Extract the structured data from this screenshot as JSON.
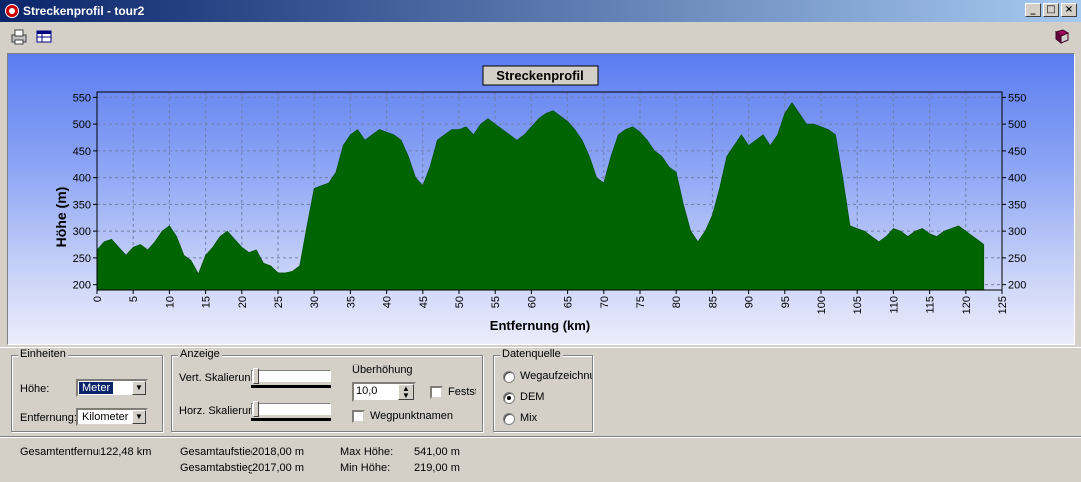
{
  "window": {
    "title": "Streckenprofil - tour2",
    "buttons": [
      "_",
      "□",
      "×"
    ]
  },
  "toolbar": {
    "icons": [
      "printer-icon",
      "table-icon",
      "book-icon"
    ]
  },
  "chart_data": {
    "type": "area",
    "title": "Streckenprofil",
    "xlabel": "Entfernung (km)",
    "ylabel": "Höhe (m)",
    "xlim": [
      0,
      125
    ],
    "ylim": [
      190,
      560
    ],
    "xticks": [
      0,
      5,
      10,
      15,
      20,
      25,
      30,
      35,
      40,
      45,
      50,
      55,
      60,
      65,
      70,
      75,
      80,
      85,
      90,
      95,
      100,
      105,
      110,
      115,
      120,
      125
    ],
    "yticks": [
      200,
      250,
      300,
      350,
      400,
      450,
      500,
      550
    ],
    "grid": true,
    "color": "#006400",
    "x": [
      0,
      1,
      2,
      3,
      4,
      5,
      6,
      7,
      8,
      9,
      10,
      11,
      12,
      13,
      14,
      15,
      16,
      17,
      18,
      19,
      20,
      21,
      22,
      23,
      24,
      25,
      26,
      27,
      28,
      29,
      30,
      31,
      32,
      33,
      34,
      35,
      36,
      37,
      38,
      39,
      40,
      41,
      42,
      43,
      44,
      45,
      46,
      47,
      48,
      49,
      50,
      51,
      52,
      53,
      54,
      55,
      56,
      57,
      58,
      59,
      60,
      61,
      62,
      63,
      64,
      65,
      66,
      67,
      68,
      69,
      70,
      71,
      72,
      73,
      74,
      75,
      76,
      77,
      78,
      79,
      80,
      81,
      82,
      83,
      84,
      85,
      86,
      87,
      88,
      89,
      90,
      91,
      92,
      93,
      94,
      95,
      96,
      97,
      98,
      99,
      100,
      101,
      102,
      103,
      104,
      105,
      106,
      107,
      108,
      109,
      110,
      111,
      112,
      113,
      114,
      115,
      116,
      117,
      118,
      119,
      120,
      121,
      122,
      122.48
    ],
    "values": [
      265,
      280,
      285,
      270,
      255,
      270,
      275,
      265,
      280,
      300,
      310,
      290,
      255,
      245,
      220,
      255,
      270,
      290,
      300,
      285,
      270,
      260,
      265,
      240,
      235,
      222,
      222,
      225,
      235,
      310,
      380,
      385,
      390,
      410,
      460,
      480,
      490,
      470,
      480,
      490,
      485,
      480,
      470,
      440,
      400,
      385,
      420,
      470,
      480,
      490,
      490,
      495,
      480,
      500,
      510,
      500,
      490,
      480,
      470,
      480,
      495,
      510,
      520,
      525,
      515,
      505,
      490,
      470,
      440,
      400,
      390,
      440,
      480,
      490,
      495,
      485,
      470,
      450,
      440,
      420,
      410,
      350,
      300,
      280,
      300,
      330,
      380,
      440,
      460,
      480,
      460,
      470,
      480,
      460,
      480,
      520,
      540,
      520,
      500,
      500,
      495,
      490,
      480,
      400,
      310,
      305,
      300,
      290,
      280,
      290,
      305,
      300,
      290,
      300,
      305,
      295,
      290,
      300,
      305,
      310,
      300,
      290,
      280,
      275,
      285,
      280,
      275,
      270
    ]
  },
  "einheiten": {
    "title": "Einheiten",
    "hoehe_label": "Höhe:",
    "hoehe_value": "Meter",
    "entfernung_label": "Entfernung:",
    "entfernung_value": "Kilometer"
  },
  "anzeige": {
    "title": "Anzeige",
    "vert_label": "Vert. Skalierung",
    "horz_label": "Horz. Skalierung",
    "ueberhoehung_label": "Überhöhung",
    "ueberhoehung_value": "10,0",
    "festst_label": "Festst",
    "wegpunkt_label": "Wegpunktnamen"
  },
  "datenquelle": {
    "title": "Datenquelle",
    "options": [
      "Wegaufzeichnung",
      "DEM",
      "Mix"
    ],
    "selected": "DEM"
  },
  "stats": {
    "gesamtentfernung_label": "Gesamtentfernung",
    "gesamtentfernung_value": "122,48 km",
    "aufstieg_label": "Gesamtaufstieg",
    "aufstieg_value": "2018,00 m",
    "abstieg_label": "Gesamtabstieg",
    "abstieg_value": "2017,00 m",
    "max_label": "Max Höhe:",
    "max_value": "541,00 m",
    "min_label": "Min Höhe:",
    "min_value": "219,00 m"
  }
}
